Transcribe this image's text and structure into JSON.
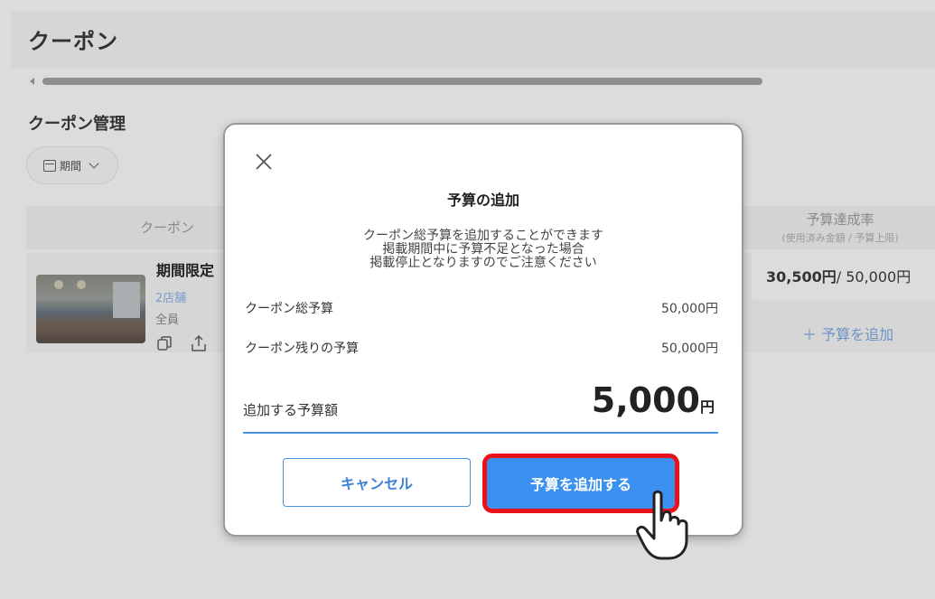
{
  "page": {
    "title": "クーポン",
    "section_title": "クーポン管理",
    "period_button": "期間"
  },
  "table": {
    "col_coupon": "クーポン",
    "col_rate": "予算達成率",
    "col_rate_sub": "(使用済み金額 / 予算上限)",
    "row": {
      "name": "期間限定",
      "stores": "2店舗",
      "target": "全員",
      "used_amount": "30,500円",
      "budget_limit": "/ 50,000円",
      "add_budget_link": "＋ 予算を追加"
    }
  },
  "modal": {
    "title": "予算の追加",
    "desc_line1": "クーポン総予算を追加することができます",
    "desc_line2": "掲載期間中に予算不足となった場合",
    "desc_line3": "掲載停止となりますのでご注意ください",
    "total_budget_label": "クーポン総予算",
    "total_budget_value": "50,000円",
    "remaining_budget_label": "クーポン残りの予算",
    "remaining_budget_value": "50,000円",
    "add_amount_label": "追加する予算額",
    "add_amount_value": "5,000",
    "add_amount_unit": "円",
    "cancel_button": "キャンセル",
    "submit_button": "予算を追加する"
  },
  "colors": {
    "accent": "#3b90f0",
    "highlight": "#e8121b",
    "link": "#6e93c6"
  },
  "icons": [
    "close-icon",
    "calendar-icon",
    "chevron-down-icon",
    "copy-icon",
    "share-icon",
    "pointer-hand-icon"
  ]
}
